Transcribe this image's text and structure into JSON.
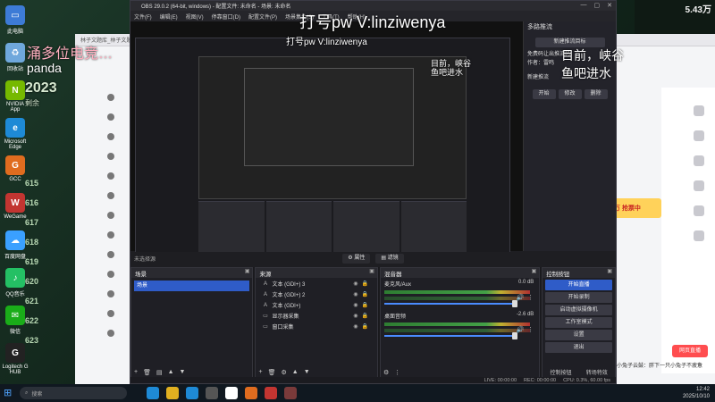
{
  "desktop": {
    "icons": [
      {
        "label": "此电脑",
        "glyph": "▭",
        "color": "#3d7bd6"
      },
      {
        "label": "回收站",
        "glyph": "♻",
        "color": "#6fa8dc"
      },
      {
        "label": "NVIDIA App",
        "glyph": "N",
        "color": "#76b900"
      },
      {
        "label": "Microsoft Edge",
        "glyph": "e",
        "color": "#1e8ad6"
      },
      {
        "label": "GCC",
        "glyph": "G",
        "color": "#e06c1f"
      },
      {
        "label": "WeGame",
        "glyph": "W",
        "color": "#c23531"
      },
      {
        "label": "百度网盘",
        "glyph": "☁",
        "color": "#3aa0ff"
      },
      {
        "label": "QQ音乐",
        "glyph": "♪",
        "color": "#24c064"
      },
      {
        "label": "微信",
        "glyph": "✉",
        "color": "#1aad19"
      },
      {
        "label": "Logitech G HUB",
        "glyph": "G",
        "color": "#222222"
      }
    ],
    "side_numbers": [
      "615",
      "616",
      "617",
      "618",
      "619",
      "620",
      "621",
      "622",
      "623"
    ],
    "year_text": "2023",
    "remaining_text": "剩余"
  },
  "top_widget": {
    "value": "5.43万"
  },
  "browser": {
    "tab_text": "林子文题库_林子文题",
    "sidebar_rows": [
      "",
      "",
      "",
      "",
      "",
      "",
      "",
      "",
      "",
      "",
      "",
      "",
      ""
    ],
    "promo_text": "10万 抢票中",
    "live_button": "网页直播",
    "comment_text": "小兔子云鼓：胖下一只小兔子不疲惫"
  },
  "obs": {
    "title": "OBS 29.0.2 (64-bit, windows) - 配置文件: 未命名 - 场景: 未命名",
    "menu": [
      "文件(F)",
      "编辑(E)",
      "视图(V)",
      "停靠窗口(D)",
      "配置文件(P)",
      "场景集合(S)",
      "工具(T)",
      "帮助(H)"
    ],
    "window_buttons": [
      "—",
      "▢",
      "✕"
    ],
    "control_panel": {
      "title": "多路推流",
      "new_target": "新建推流目标",
      "info_line1": "免费码让出推流码",
      "info_line2": "作者：雷鸣",
      "new_push": "新建推流",
      "row_buttons": [
        "开始",
        "修改",
        "删除"
      ]
    },
    "studio_bar": {
      "properties": "⚙ 属性",
      "filters": "▤ 滤镜"
    },
    "scenes": {
      "title": "场景",
      "items": [
        "场景"
      ]
    },
    "sources": {
      "title": "来源",
      "items": [
        "文本 (GDI+) 3",
        "文本 (GDI+) 2",
        "文本 (GDI+)",
        "显示器采集",
        "窗口采集"
      ]
    },
    "mixer": {
      "title": "混音器",
      "channels": [
        {
          "name": "麦克风/Aux",
          "db": "0.0 dB"
        },
        {
          "name": "桌面音频",
          "db": "-2.6 dB"
        }
      ]
    },
    "controls": {
      "title": "控制按钮",
      "buttons": [
        "开始直播",
        "开始录制",
        "启动虚拟摄像机",
        "工作室模式",
        "设置",
        "退出"
      ],
      "footer": [
        "控制按钮",
        "转场特效"
      ]
    },
    "status": {
      "live": "LIVE: 00:00:00",
      "rec": "REC: 00:00:00",
      "cpu": "CPU: 0.3%, 60.00 fps"
    },
    "preview_label": "未选择源"
  },
  "watermarks": {
    "top": "打号pw V:linziwenya",
    "top_small": "打号pw V:linziwenya",
    "left1": "涌多位电竞…",
    "left2": "panda",
    "right1": "目前，峡谷",
    "right2": "鱼吧进水",
    "mid1": "目前，峡谷",
    "mid2": "鱼吧进水"
  },
  "taskbar": {
    "search_placeholder": "搜索",
    "apps": [
      "#1e8ad6",
      "#e0b020",
      "#1e8ad6",
      "#555555",
      "#ffffff",
      "#e06c1f",
      "#c23531",
      "#7a3a3a"
    ],
    "time": "12:42",
    "date": "2025/10/10"
  }
}
